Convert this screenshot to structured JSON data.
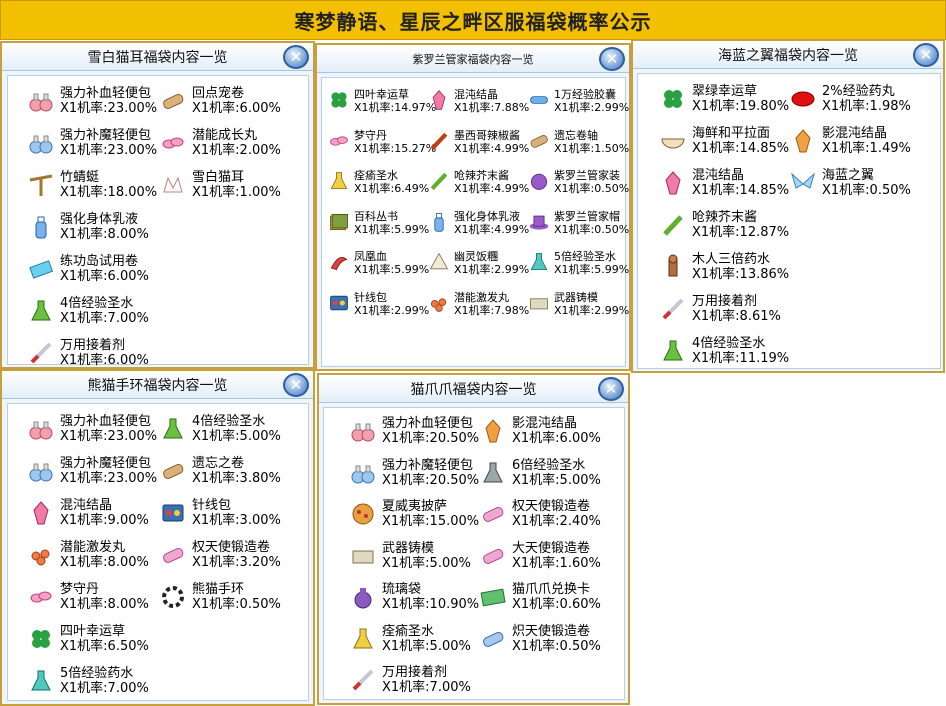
{
  "header": {
    "title": "寒梦静语、星辰之畔区服福袋概率公示"
  },
  "panels": [
    {
      "title": "雪白猫耳福袋内容一览",
      "items": [
        {
          "name": "强力补血轻便包",
          "rate": "X1机率:23.00%",
          "icon": "potion-pair-red-icon"
        },
        {
          "name": "回点宠卷",
          "rate": "X1机率:6.00%",
          "icon": "scroll-icon"
        },
        {
          "name": "强力补魔轻便包",
          "rate": "X1机率:23.00%",
          "icon": "potion-pair-blue-icon"
        },
        {
          "name": "潜能成长丸",
          "rate": "X1机率:2.00%",
          "icon": "pink-pills-icon"
        },
        {
          "name": "竹蜻蜓",
          "rate": "X1机率:18.00%",
          "icon": "bamboo-copter-icon"
        },
        {
          "name": "雪白猫耳",
          "rate": "X1机率:1.00%",
          "icon": "cat-ears-icon"
        },
        {
          "name": "强化身体乳液",
          "rate": "X1机率:8.00%",
          "icon": "lotion-bottle-icon"
        },
        {
          "name": "练功岛试用卷",
          "rate": "X1机率:6.00%",
          "icon": "ticket-icon"
        },
        {
          "name": "4倍经验圣水",
          "rate": "X1机率:7.00%",
          "icon": "green-flask-icon"
        },
        {
          "name": "万用接着剂",
          "rate": "X1机率:6.00%",
          "icon": "syringe-icon"
        }
      ]
    },
    {
      "title": "紫罗兰管家福袋内容一览",
      "items": [
        {
          "name": "四叶幸运草",
          "rate": "X1机率:14.97%",
          "icon": "clover-icon"
        },
        {
          "name": "混沌结晶",
          "rate": "X1机率:7.88%",
          "icon": "pink-crystal-icon"
        },
        {
          "name": "1万经验胶囊",
          "rate": "X1机率:2.99%",
          "icon": "capsule-icon"
        },
        {
          "name": "梦守丹",
          "rate": "X1机率:15.27%",
          "icon": "pink-pills-icon"
        },
        {
          "name": "墨西哥辣椒酱",
          "rate": "X1机率:4.99%",
          "icon": "chili-sauce-icon"
        },
        {
          "name": "遗忘卷轴",
          "rate": "X1机率:1.50%",
          "icon": "scroll-icon"
        },
        {
          "name": "痊瘉圣水",
          "rate": "X1机率:6.49%",
          "icon": "yellow-flask-icon"
        },
        {
          "name": "呛辣芥末酱",
          "rate": "X1机率:4.99%",
          "icon": "wasabi-tube-icon"
        },
        {
          "name": "紫罗兰管家装",
          "rate": "X1机率:0.50%",
          "icon": "purple-outfit-icon"
        },
        {
          "name": "百科丛书",
          "rate": "X1机率:5.99%",
          "icon": "books-icon"
        },
        {
          "name": "强化身体乳液",
          "rate": "X1机率:4.99%",
          "icon": "lotion-bottle-icon"
        },
        {
          "name": "紫罗兰管家帽",
          "rate": "X1机率:0.50%",
          "icon": "purple-hat-icon"
        },
        {
          "name": "凤凰血",
          "rate": "X1机率:5.99%",
          "icon": "phoenix-blood-icon"
        },
        {
          "name": "幽灵饭糰",
          "rate": "X1机率:2.99%",
          "icon": "rice-ball-icon"
        },
        {
          "name": "5倍经验圣水",
          "rate": "X1机率:5.99%",
          "icon": "teal-flask-icon"
        },
        {
          "name": "针线包",
          "rate": "X1机率:2.99%",
          "icon": "sewing-kit-icon"
        },
        {
          "name": "潜能激发丸",
          "rate": "X1机率:7.98%",
          "icon": "orange-pills-icon"
        },
        {
          "name": "武器铸模",
          "rate": "X1机率:2.99%",
          "icon": "weapon-mold-icon"
        }
      ]
    },
    {
      "title": "海蓝之翼福袋内容一览",
      "items": [
        {
          "name": "翠绿幸运草",
          "rate": "X1机率:19.80%",
          "icon": "clover-icon"
        },
        {
          "name": "2%经验药丸",
          "rate": "X1机率:1.98%",
          "icon": "red-pill-icon"
        },
        {
          "name": "海鲜和平拉面",
          "rate": "X1机率:14.85%",
          "icon": "ramen-bowl-icon"
        },
        {
          "name": "影混沌结晶",
          "rate": "X1机率:1.49%",
          "icon": "orange-crystal-icon"
        },
        {
          "name": "混沌结晶",
          "rate": "X1机率:14.85%",
          "icon": "pink-crystal-icon"
        },
        {
          "name": "海蓝之翼",
          "rate": "X1机率:0.50%",
          "icon": "blue-wings-icon"
        },
        {
          "name": "呛辣芥末酱",
          "rate": "X1机率:12.87%",
          "icon": "wasabi-tube-icon"
        },
        {
          "name": "木人三倍药水",
          "rate": "X1机率:13.86%",
          "icon": "wooden-figure-icon"
        },
        {
          "name": "万用接着剂",
          "rate": "X1机率:8.61%",
          "icon": "syringe-icon"
        },
        {
          "name": "4倍经验圣水",
          "rate": "X1机率:11.19%",
          "icon": "green-flask-icon"
        }
      ]
    },
    {
      "title": "熊猫手环福袋内容一览",
      "items": [
        {
          "name": "强力补血轻便包",
          "rate": "X1机率:23.00%",
          "icon": "potion-pair-red-icon"
        },
        {
          "name": "4倍经验圣水",
          "rate": "X1机率:5.00%",
          "icon": "green-flask-icon"
        },
        {
          "name": "强力补魔轻便包",
          "rate": "X1机率:23.00%",
          "icon": "potion-pair-blue-icon"
        },
        {
          "name": "遗忘之卷",
          "rate": "X1机率:3.80%",
          "icon": "scroll-icon"
        },
        {
          "name": "混沌结晶",
          "rate": "X1机率:9.00%",
          "icon": "pink-crystal-icon"
        },
        {
          "name": "针线包",
          "rate": "X1机率:3.00%",
          "icon": "sewing-kit-icon"
        },
        {
          "name": "潜能激发丸",
          "rate": "X1机率:8.00%",
          "icon": "orange-pills-icon"
        },
        {
          "name": "权天使锻造卷",
          "rate": "X1机率:3.20%",
          "icon": "pink-scroll-icon"
        },
        {
          "name": "梦守丹",
          "rate": "X1机率:8.00%",
          "icon": "pink-pills-icon"
        },
        {
          "name": "熊猫手环",
          "rate": "X1机率:0.50%",
          "icon": "panda-bracelet-icon"
        },
        {
          "name": "四叶幸运草",
          "rate": "X1机率:6.50%",
          "icon": "clover-icon"
        },
        {
          "name": "5倍经验药水",
          "rate": "X1机率:7.00%",
          "icon": "teal-flask-icon"
        }
      ]
    },
    {
      "title": "猫爪爪福袋内容一览",
      "items": [
        {
          "name": "强力补血轻便包",
          "rate": "X1机率:20.50%",
          "icon": "potion-pair-red-icon"
        },
        {
          "name": "影混沌结晶",
          "rate": "X1机率:6.00%",
          "icon": "orange-crystal-icon"
        },
        {
          "name": "强力补魔轻便包",
          "rate": "X1机率:20.50%",
          "icon": "potion-pair-blue-icon"
        },
        {
          "name": "6倍经验圣水",
          "rate": "X1机率:5.00%",
          "icon": "gray-flask-icon"
        },
        {
          "name": "夏威夷披萨",
          "rate": "X1机率:15.00%",
          "icon": "pizza-icon"
        },
        {
          "name": "权天使锻造卷",
          "rate": "X1机率:2.40%",
          "icon": "pink-scroll-icon"
        },
        {
          "name": "武器铸模",
          "rate": "X1机率:5.00%",
          "icon": "weapon-mold-icon"
        },
        {
          "name": "大天使锻造卷",
          "rate": "X1机率:1.60%",
          "icon": "pink-scroll-icon"
        },
        {
          "name": "琉璃袋",
          "rate": "X1机率:10.90%",
          "icon": "purple-bag-icon"
        },
        {
          "name": "猫爪爪兑换卡",
          "rate": "X1机率:0.60%",
          "icon": "exchange-card-icon"
        },
        {
          "name": "痊瘉圣水",
          "rate": "X1机率:5.00%",
          "icon": "yellow-flask-icon"
        },
        {
          "name": "炽天使锻造卷",
          "rate": "X1机率:0.50%",
          "icon": "blue-scroll-icon"
        },
        {
          "name": "万用接着剂",
          "rate": "X1机率:7.00%",
          "icon": "syringe-icon"
        }
      ]
    }
  ]
}
